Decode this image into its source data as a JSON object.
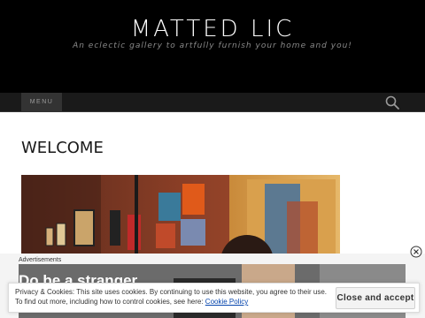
{
  "header": {
    "site_title": "MATTED LIC",
    "site_description": "An eclectic gallery to artfully furnish your home and you!"
  },
  "nav": {
    "menu_label": "MENU",
    "search_icon": "search-icon"
  },
  "main": {
    "page_title": "WELCOME",
    "hero_image": "gallery-interior-photo"
  },
  "ad": {
    "label": "Advertisements",
    "headline": "Do be a stranger",
    "close_icon": "close-circle-icon"
  },
  "cookie_banner": {
    "line1": "Privacy & Cookies: This site uses cookies. By continuing to use this website, you agree to their use.",
    "line2_prefix": "To find out more, including how to control cookies, see here: ",
    "policy_link": "Cookie Policy",
    "accept_label": "Close and accept"
  },
  "colors": {
    "header_bg": "#000000",
    "nav_bg": "#1a1a1a",
    "link": "#0645ad"
  }
}
